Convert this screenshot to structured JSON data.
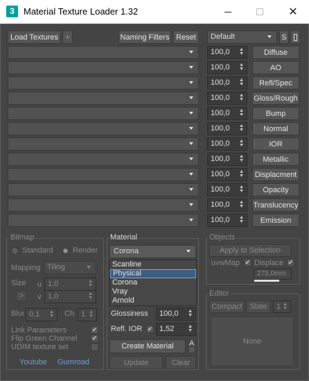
{
  "window": {
    "app_icon_text": "3",
    "title": "Material Texture Loader 1.32",
    "close_glyph": "✕"
  },
  "toolbar": {
    "load_textures": "Load Textures",
    "add": "+",
    "naming_filters": "Naming Filters",
    "reset": "Reset",
    "preset": "Default",
    "s_button": "S"
  },
  "maps": [
    {
      "amount": "100,0",
      "label": "Diffuse"
    },
    {
      "amount": "100,0",
      "label": "AO"
    },
    {
      "amount": "100,0",
      "label": "Refl/Spec"
    },
    {
      "amount": "100,0",
      "label": "Gloss/Rough"
    },
    {
      "amount": "100,0",
      "label": "Bump"
    },
    {
      "amount": "100,0",
      "label": "Normal"
    },
    {
      "amount": "100,0",
      "label": "IOR"
    },
    {
      "amount": "100,0",
      "label": "Metallic"
    },
    {
      "amount": "100,0",
      "label": "Displacment"
    },
    {
      "amount": "100,0",
      "label": "Opacity"
    },
    {
      "amount": "100,0",
      "label": "Translucency"
    },
    {
      "amount": "100,0",
      "label": "Emission"
    }
  ],
  "bitmap": {
    "title": "Bitmap",
    "standard": "Standard",
    "render": "Render",
    "mapping_label": "Mapping",
    "mapping_value": "Tiling",
    "size_label": "Size",
    "u_label": "u",
    "u_value": "1,0",
    "v_label": "v",
    "v_value": "1,0",
    "lock_glyph": ">",
    "blur_label": "Blur",
    "blur_value": "0,1",
    "ch_label": "Ch",
    "ch_value": "1",
    "link_parameters": "Link Parameters",
    "flip_green": "Flip Green Channel",
    "udim": "UDIM texture set",
    "youtube": "Youtube",
    "gumroad": "Gumroad"
  },
  "material": {
    "title": "Material",
    "selected": "Corona",
    "options": [
      "Scanline",
      "Physical",
      "Corona",
      "Vray",
      "Arnold"
    ],
    "highlighted_index": 1,
    "glossiness_label": "Glossiness",
    "glossiness_value": "100,0",
    "refl_ior_label": "Refl. IOR",
    "refl_ior_value": "1,52",
    "create_material": "Create Material",
    "a_button": "A",
    "update": "Update",
    "clear": "Clear"
  },
  "objects": {
    "title": "Objects",
    "apply": "Apply to Selection",
    "uvwmap": "uvwMap",
    "displace": "Displace",
    "displace_value": "275,0mm"
  },
  "editor": {
    "title": "Editor",
    "compact": "Compact",
    "slate": "Slate",
    "slot": "1",
    "none": "None"
  },
  "glyphs": {
    "check": "✔",
    "spin_up": "▲",
    "spin_down": "▼"
  }
}
